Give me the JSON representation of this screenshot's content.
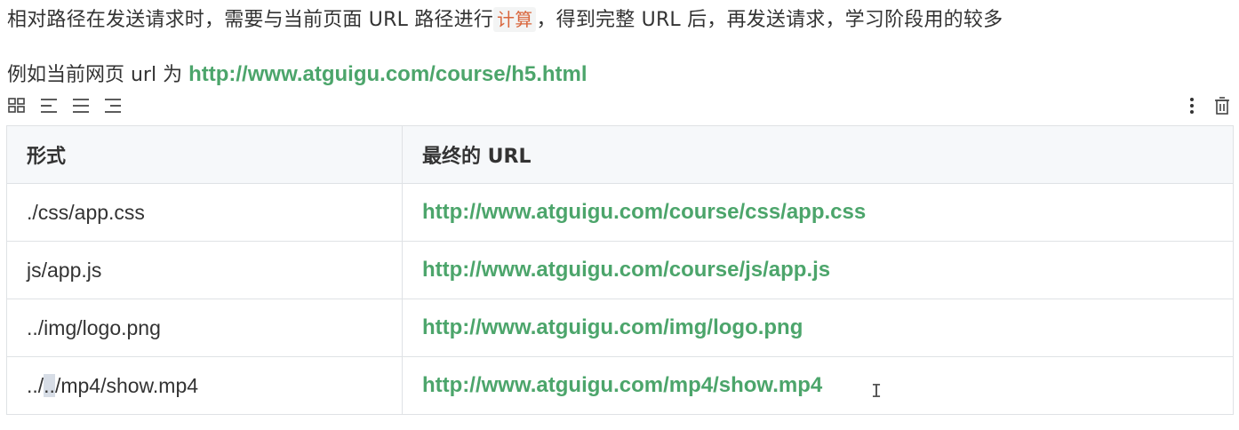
{
  "intro": {
    "text_before": "相对路径在发送请求时，需要与当前页面 URL 路径进行",
    "code": "计算",
    "text_after": "，得到完整 URL 后，再发送请求，学习阶段用的较多"
  },
  "example": {
    "prefix": "例如当前网页 url 为 ",
    "url": "http://www.atguigu.com/course/h5.html"
  },
  "toolbar": {
    "left_icons": [
      "grid-icon",
      "align-left-icon",
      "align-center-icon",
      "align-right-icon"
    ],
    "right_icons": [
      "more-vertical-icon",
      "trash-icon"
    ]
  },
  "table": {
    "headers": [
      "形式",
      "最终的 URL"
    ],
    "rows": [
      [
        "./css/app.css",
        "http://www.atguigu.com/course/css/app.css"
      ],
      [
        "js/app.js",
        "http://www.atguigu.com/course/js/app.js"
      ],
      [
        "../img/logo.png",
        "http://www.atguigu.com/img/logo.png"
      ],
      [
        "../../mp4/show.mp4",
        "http://www.atguigu.com/mp4/show.mp4"
      ]
    ],
    "row4_parts": [
      "../",
      "..",
      "/mp4/show.mp4"
    ]
  },
  "colors": {
    "link": "#4ca56b",
    "inline_code": "#d9663d",
    "header_bg": "#f6f8fa",
    "border": "#dfe2e5"
  }
}
